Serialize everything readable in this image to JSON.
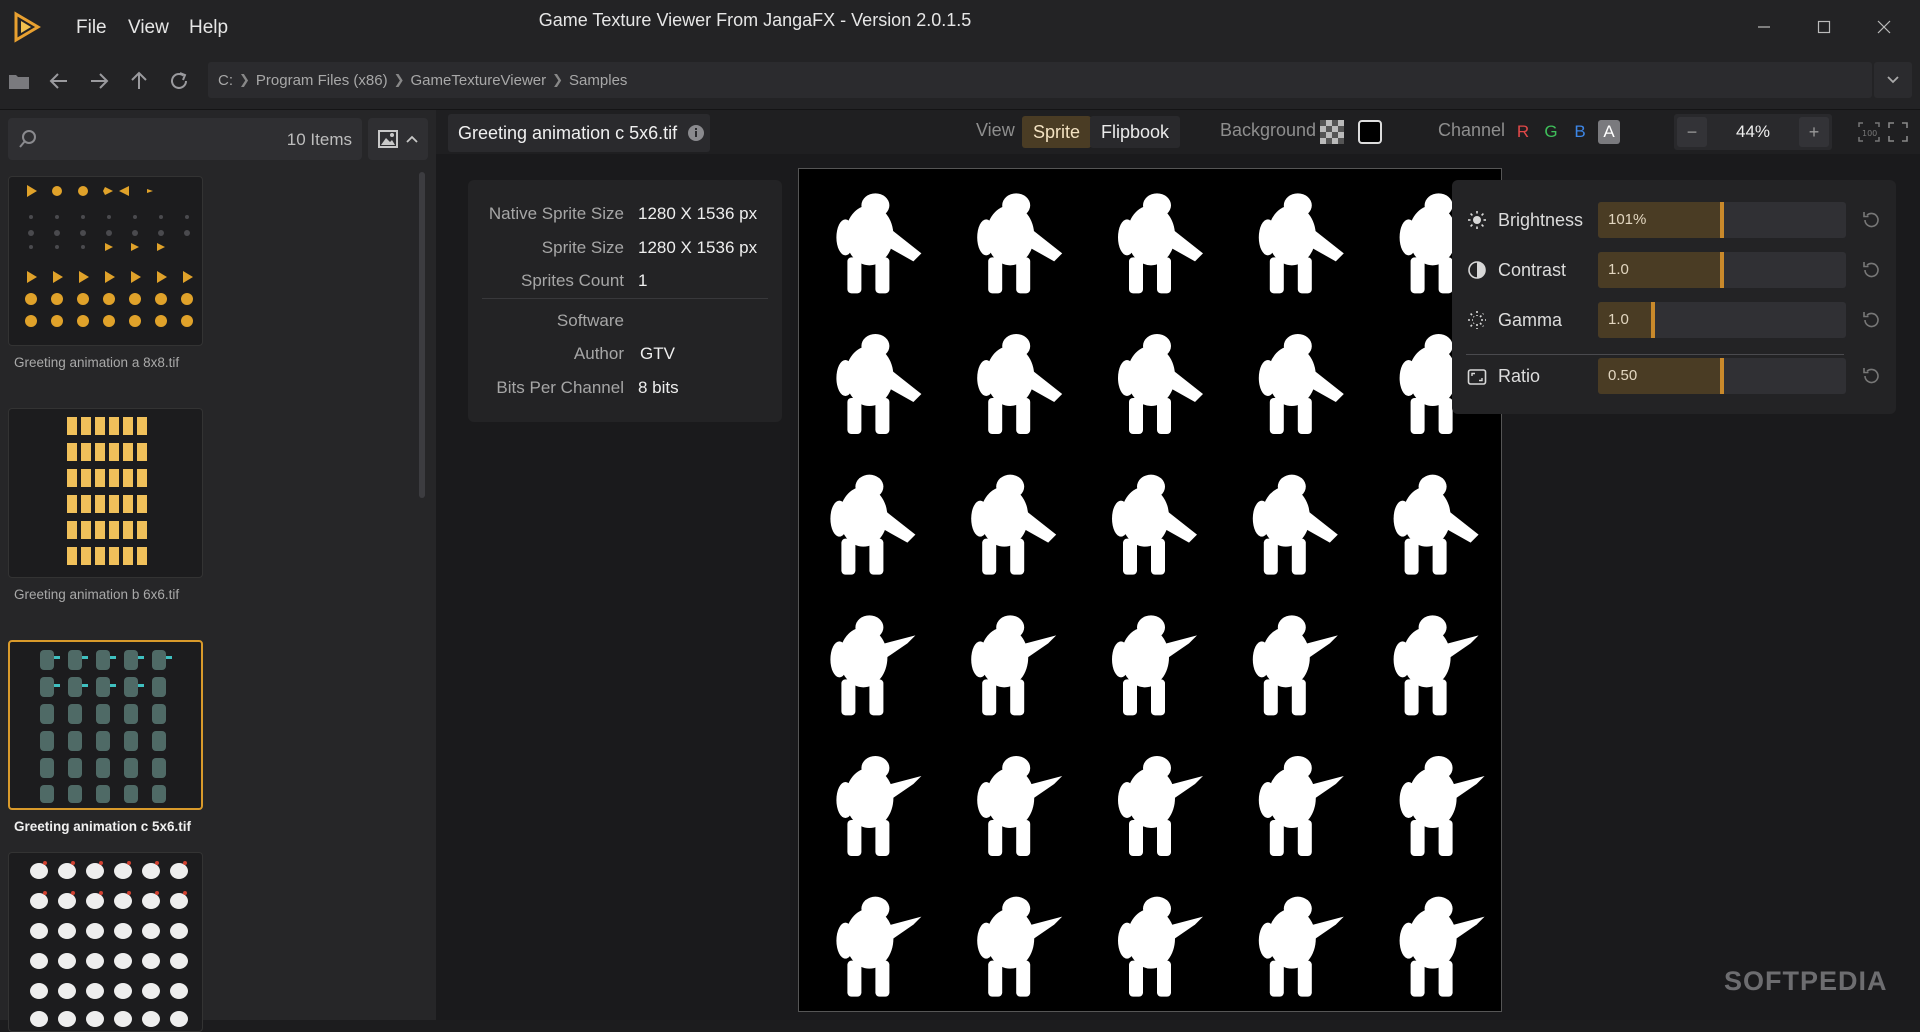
{
  "window": {
    "title": "Game Texture Viewer From JangaFX - Version 2.0.1.5",
    "menu": [
      "File",
      "View",
      "Help"
    ]
  },
  "path": {
    "crumbs": [
      "C:",
      "Program Files (x86)",
      "GameTextureViewer",
      "Samples"
    ]
  },
  "sidebar": {
    "items_count": "10 Items",
    "thumbnails": [
      {
        "label": "Greeting animation a 8x8.tif",
        "selected": false
      },
      {
        "label": "Greeting animation b 6x6.tif",
        "selected": false
      },
      {
        "label": "Greeting animation c 5x6.tif",
        "selected": true
      },
      {
        "label": "",
        "selected": false
      }
    ]
  },
  "toolbar": {
    "file_name": "Greeting animation c 5x6.tif",
    "view_label": "View",
    "view_modes": [
      "Sprite",
      "Flipbook"
    ],
    "active_view": "Sprite",
    "background_label": "Background",
    "channel_label": "Channel",
    "channels": [
      "R",
      "G",
      "B",
      "A"
    ],
    "active_channel": "A",
    "channel_colors": {
      "R": "#e04848",
      "G": "#3fbf5a",
      "B": "#3d86e6",
      "A": "#ffffff"
    },
    "zoom": "44%"
  },
  "info": {
    "native_sprite_size_label": "Native Sprite Size",
    "native_sprite_size": "1280 X 1536 px",
    "sprite_size_label": "Sprite Size",
    "sprite_size": "1280 X 1536 px",
    "sprites_count_label": "Sprites Count",
    "sprites_count": "1",
    "software_label": "Software",
    "software": "",
    "author_label": "Author",
    "author": "GTV",
    "bits_label": "Bits Per Channel",
    "bits": "8 bits"
  },
  "adjustments": {
    "brightness_label": "Brightness",
    "brightness_value": "101%",
    "brightness_level": 0.5,
    "contrast_label": "Contrast",
    "contrast_value": "1.0",
    "contrast_level": 0.5,
    "gamma_label": "Gamma",
    "gamma_value": "1.0",
    "gamma_level": 0.22,
    "ratio_label": "Ratio",
    "ratio_value": "0.50",
    "ratio_level": 0.5
  },
  "sprite_sheet": {
    "columns": 5,
    "rows": 6
  },
  "colors": {
    "accent": "#d99a2b",
    "accent_dark": "#4a3c24"
  },
  "watermark": "SOFTPEDIA"
}
